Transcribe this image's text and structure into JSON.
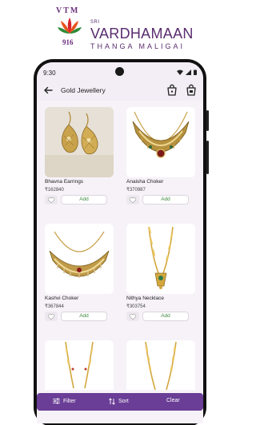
{
  "brand": {
    "logo_letters": "VTM",
    "logo_number": "916",
    "prefix": "SRI",
    "name": "VARDHAMAAN",
    "tagline": "THANGA MALIGAI"
  },
  "status_bar": {
    "time": "9:30"
  },
  "app_bar": {
    "title": "Gold Jewellery"
  },
  "products": [
    {
      "name": "Bhavna Earrings",
      "price": "₹162840",
      "add_label": "Add"
    },
    {
      "name": "Anaisha Choker",
      "price": "₹370987",
      "add_label": "Add"
    },
    {
      "name": "Kashvi Choker",
      "price": "₹367844",
      "add_label": "Add"
    },
    {
      "name": "Nithya Necklace",
      "price": "₹303754",
      "add_label": "Add"
    }
  ],
  "bottom_bar": {
    "filter": "Filter",
    "sort": "Sort",
    "clear": "Clear"
  },
  "icons": {
    "back": "arrow-left-icon",
    "bag_1": "shopping-bag-icon",
    "bag_2": "shopping-bag-icon",
    "favorite": "heart-icon",
    "filter": "sliders-icon",
    "sort": "sort-arrows-icon"
  },
  "colors": {
    "brand": "#5a2c6e",
    "bottom_bar": "#6a3d96",
    "add_text": "#3f8a3f",
    "screen_bg": "#f6f2f8"
  }
}
